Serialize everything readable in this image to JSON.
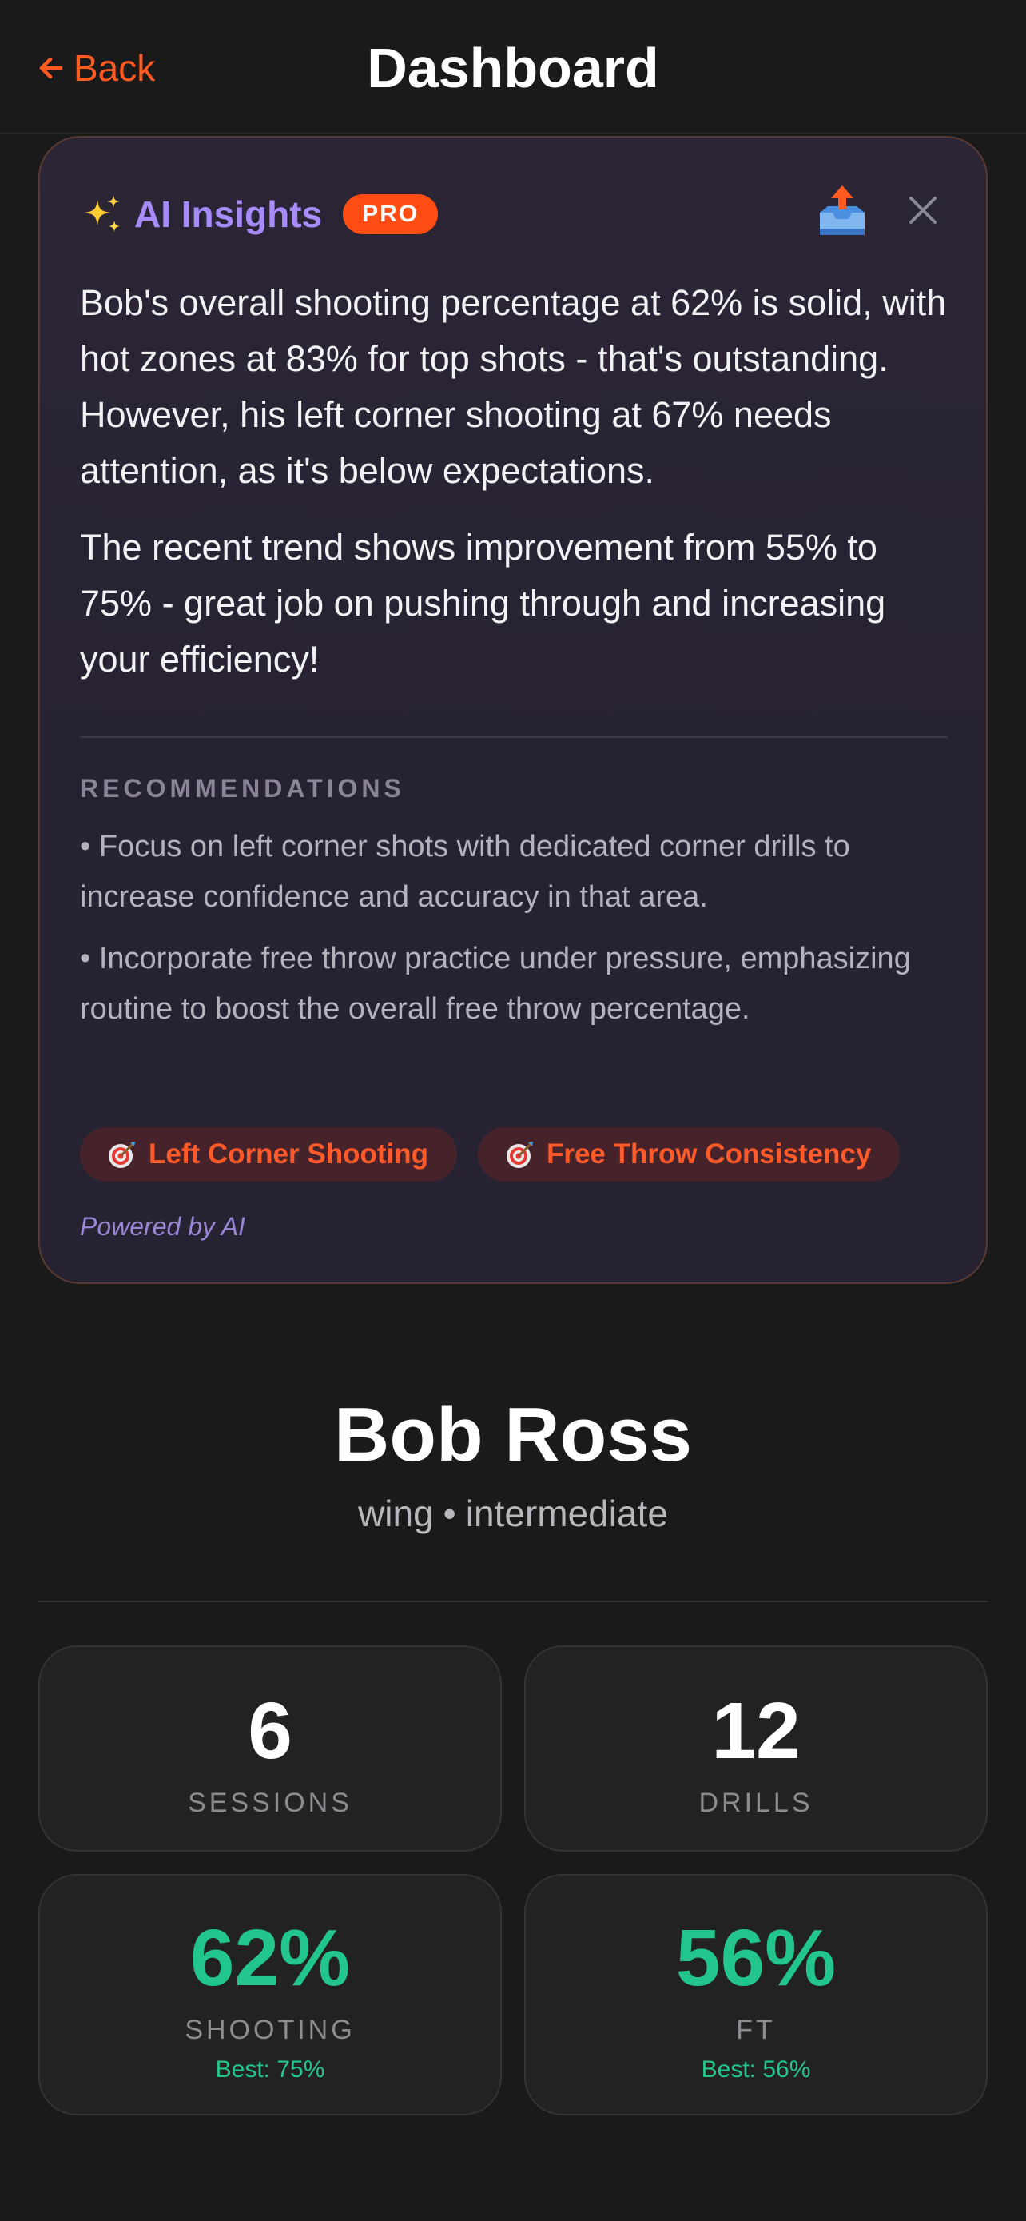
{
  "header": {
    "back_label": "Back",
    "title": "Dashboard"
  },
  "ai_insights": {
    "title": "AI Insights",
    "badge": "PRO",
    "paragraphs": [
      "Bob's overall shooting percentage at 62% is solid, with hot zones at 83% for top shots - that's outstanding. However, his left corner shooting at 67% needs attention, as it's below expectations.",
      "The recent trend shows improvement from 55% to 75% - great job on pushing through and increasing your efficiency!"
    ],
    "recommendations_title": "RECOMMENDATIONS",
    "recommendations": [
      "• Focus on left corner shots with dedicated corner drills to increase confidence and accuracy in that area.",
      "• Incorporate free throw practice under pressure, emphasizing routine to boost the overall free throw percentage."
    ],
    "chips": [
      "Left Corner Shooting",
      "Free Throw Consistency"
    ],
    "footer": "Powered by AI",
    "icons": {
      "title_icon": "sparkles-icon",
      "export_icon": "outbox-tray-icon",
      "close_icon": "close-icon",
      "chip_icon": "target-icon"
    }
  },
  "player": {
    "name": "Bob Ross",
    "position": "wing",
    "separator": "•",
    "level": "intermediate"
  },
  "stats": {
    "sessions": {
      "value": "6",
      "label": "SESSIONS"
    },
    "drills": {
      "value": "12",
      "label": "DRILLS"
    },
    "shooting": {
      "value": "62%",
      "label": "SHOOTING",
      "best": "Best: 75%"
    },
    "ft": {
      "value": "56%",
      "label": "FT",
      "best": "Best: 56%"
    }
  },
  "colors": {
    "accent": "#ff5a1f",
    "ai_purple": "#a78bfa",
    "success_green": "#22c58b",
    "background": "#1a1a1b"
  }
}
